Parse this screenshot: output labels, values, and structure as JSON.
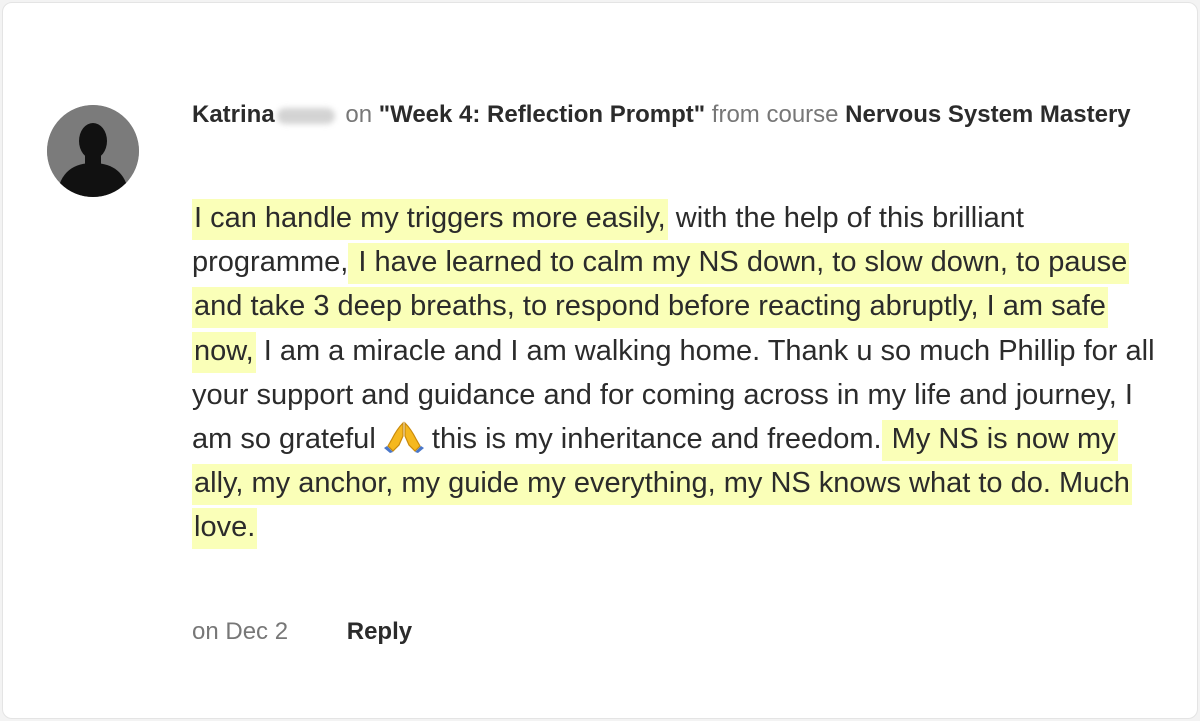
{
  "comment": {
    "author": "Katrina",
    "on_word": "on",
    "prompt_title": "\"Week 4: Reflection Prompt\"",
    "from_course_word": "from course",
    "course_name": "Nervous System Mastery",
    "segments": [
      "I can handle my triggers more easily,",
      " with the help of this brilliant programme,",
      " I have learned to calm my NS down, to slow down, to pause and take 3 deep breaths, to respond before reacting abruptly, I am safe now,",
      " I am a miracle and I am walking home. Thank u so much Phillip for all your support and guidance and for coming across in my life and journey, I am so grateful ",
      "🙏",
      " this is my inheritance and freedom.",
      " My NS is now my ally, my anchor, my guide my everything, my NS knows what to do. Much love. "
    ],
    "date": "on Dec 2",
    "reply_label": "Reply",
    "highlight_color": "#faffb8",
    "avatar_icon": "person-silhouette-icon",
    "emoji_icon": "folded-hands-icon"
  }
}
